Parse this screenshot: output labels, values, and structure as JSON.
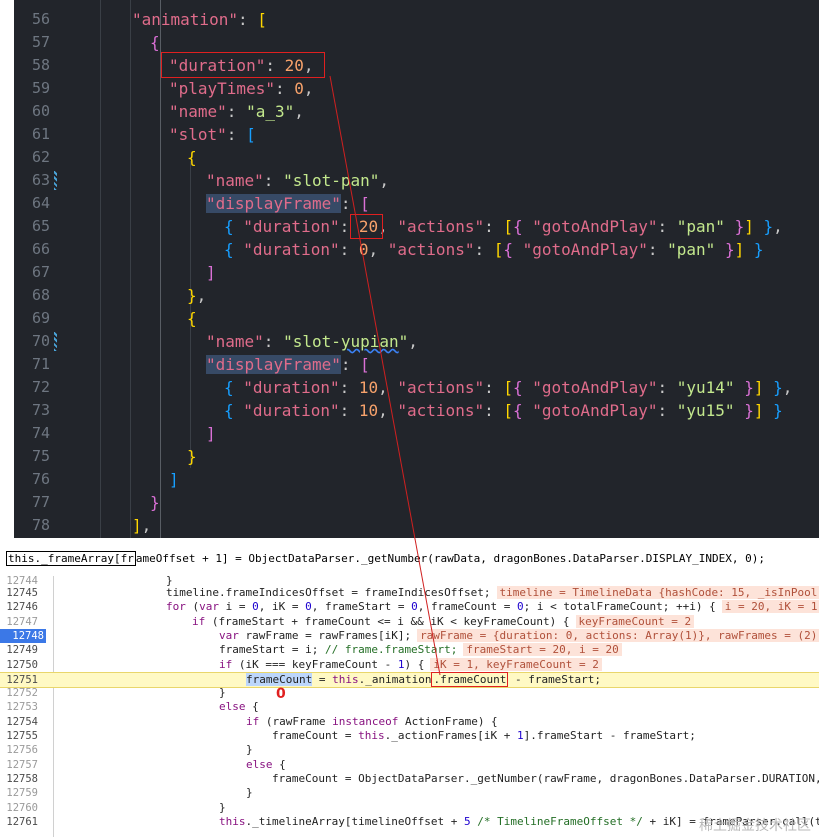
{
  "editor": {
    "lines": [
      {
        "num": "56"
      },
      {
        "num": "57"
      },
      {
        "num": "58"
      },
      {
        "num": "59"
      },
      {
        "num": "60"
      },
      {
        "num": "61"
      },
      {
        "num": "62"
      },
      {
        "num": "63"
      },
      {
        "num": "64"
      },
      {
        "num": "65"
      },
      {
        "num": "66"
      },
      {
        "num": "67"
      },
      {
        "num": "68"
      },
      {
        "num": "69"
      },
      {
        "num": "70"
      },
      {
        "num": "71"
      },
      {
        "num": "72"
      },
      {
        "num": "73"
      },
      {
        "num": "74"
      },
      {
        "num": "75"
      },
      {
        "num": "76"
      },
      {
        "num": "77"
      },
      {
        "num": "78"
      }
    ],
    "k_animation": "\"animation\"",
    "k_duration": "\"duration\"",
    "v_duration": "20",
    "k_playTimes": "\"playTimes\"",
    "v_playTimes": "0",
    "k_name": "\"name\"",
    "v_name": "\"a_3\"",
    "k_slot": "\"slot\"",
    "v_slot_pan": "\"slot-pan\"",
    "k_displayFrame": "displayFrame",
    "v_actions_key": "\"actions\"",
    "v_goto": "\"gotoAndPlay\"",
    "v_pan": "\"pan\"",
    "v_df1_dur": "20",
    "v_df2_dur": "0",
    "v_slot_yupian_a": "\"slot-",
    "v_slot_yupian_b": "yupian",
    "v_slot_yupian_c": "\"",
    "v_df3_dur": "10",
    "v_df4_dur": "10",
    "v_yu14": "\"yu14\"",
    "v_yu15": "\"yu15\""
  },
  "debugger": {
    "statement": {
      "a": "this._frameArray[fr",
      "b": "ameOffset + 1] = ObjectDataParser._getNumber(rawData, dragonBones.DataParser.DISPLAY_INDEX, 0);"
    },
    "lines": [
      {
        "num": "12744",
        "small": true
      },
      {
        "num": "12745"
      },
      {
        "num": "12746"
      },
      {
        "num": "12747",
        "small": true
      },
      {
        "num": "12748",
        "bp": true
      },
      {
        "num": "12749"
      },
      {
        "num": "12750"
      },
      {
        "num": "12751"
      },
      {
        "num": "12752",
        "small": true
      },
      {
        "num": "12753",
        "small": true
      },
      {
        "num": "12754"
      },
      {
        "num": "12755"
      },
      {
        "num": "12756",
        "small": true
      },
      {
        "num": "12757",
        "small": true
      },
      {
        "num": "12758"
      },
      {
        "num": "12759",
        "small": true
      },
      {
        "num": "12760",
        "small": true
      },
      {
        "num": "12761"
      }
    ],
    "inline": {
      "l12745": "timeline = TimelineData {hashCode: 15, _isInPool",
      "l12746": "i = 20, iK = 1",
      "l12747": "keyFrameCount = 2",
      "l12748": "rawFrame = {duration: 0, actions: Array(1)}, rawFrames = (2)",
      "l12749": "frameStart = 20, i = 20",
      "l12750": "iK = 1, keyFrameCount = 2"
    },
    "annotation_zero": "0",
    "watermark": "稀土掘金技术社区"
  }
}
